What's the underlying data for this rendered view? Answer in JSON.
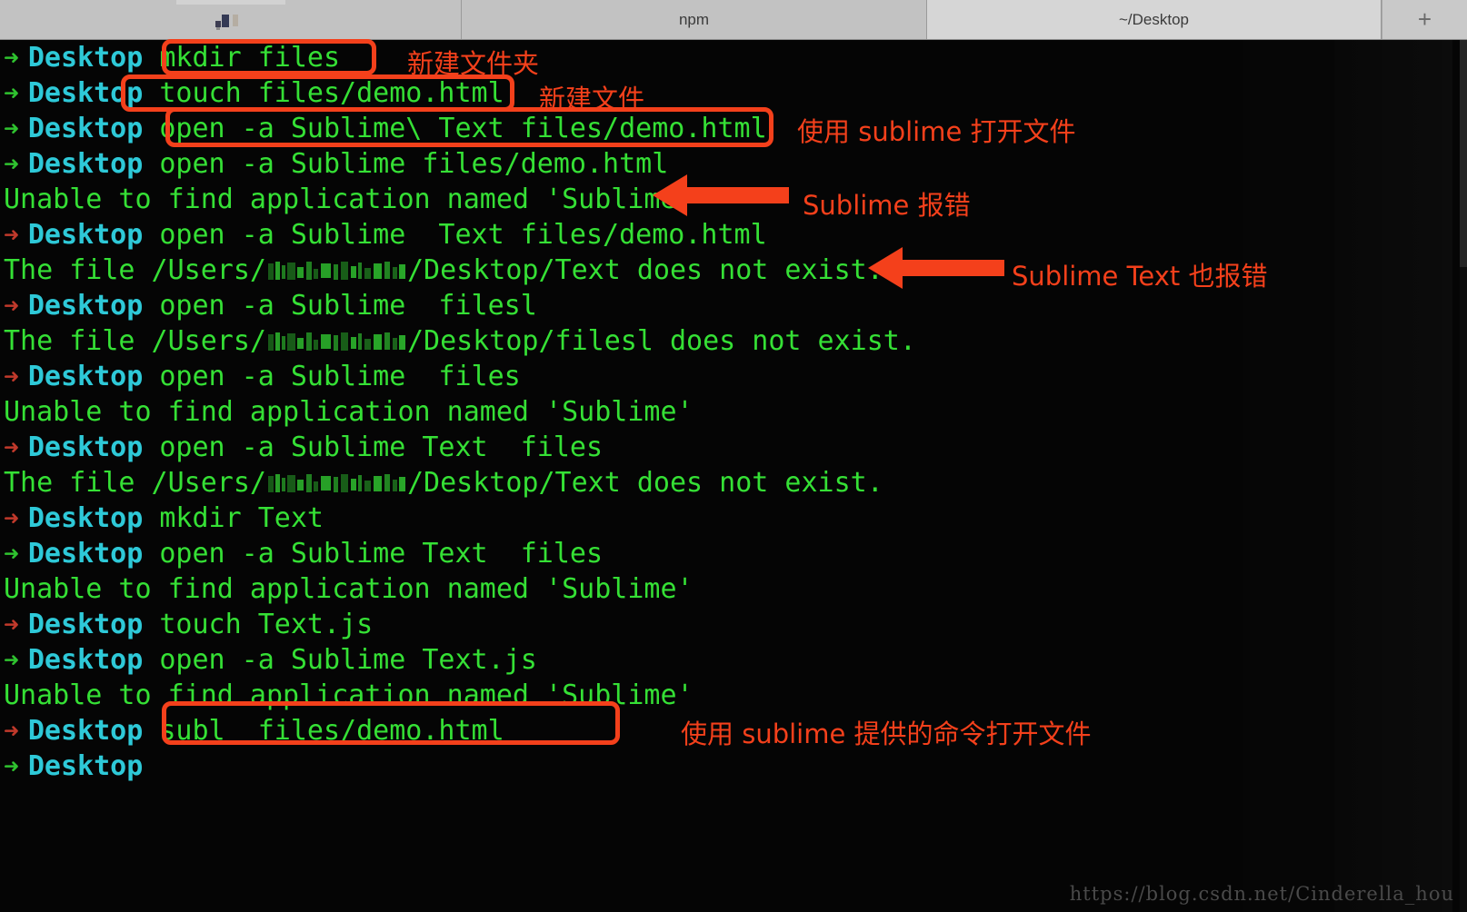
{
  "window": {
    "tabs": [
      {
        "label": "",
        "obscured": true,
        "active": false
      },
      {
        "label": "npm",
        "obscured": false,
        "active": false
      },
      {
        "label": "~/Desktop",
        "obscured": false,
        "active": true
      }
    ],
    "new_tab_label": "+"
  },
  "theme": {
    "background": "#050505",
    "tabbar_bg": "#c2c2c2",
    "tab_active_bg": "#d6d6d6",
    "prompt_arrow_green": "#2fc22f",
    "prompt_arrow_red": "#c0392b",
    "cwd_color": "#2ec9d8",
    "command_color": "#35e035",
    "output_color": "#35e035",
    "annotation_color": "#f4401b",
    "watermark_color": "#4a4a4a"
  },
  "terminal": {
    "prompt_cwd": "Desktop",
    "lines": [
      {
        "type": "prompt",
        "arrow": "green",
        "cwd": "Desktop",
        "command": "mkdir files"
      },
      {
        "type": "prompt",
        "arrow": "green",
        "cwd": "Desktop",
        "command": "touch files/demo.html"
      },
      {
        "type": "prompt",
        "arrow": "green",
        "cwd": "Desktop",
        "command": "open -a Sublime\\ Text files/demo.html"
      },
      {
        "type": "prompt",
        "arrow": "green",
        "cwd": "Desktop",
        "command": "open -a Sublime files/demo.html"
      },
      {
        "type": "output",
        "text": "Unable to find application named 'Sublime'"
      },
      {
        "type": "prompt",
        "arrow": "red",
        "cwd": "Desktop",
        "command": "open -a Sublime  Text files/demo.html"
      },
      {
        "type": "output-path",
        "prefix": "The file /Users/",
        "suffix": "/Desktop/Text does not exist."
      },
      {
        "type": "prompt",
        "arrow": "red",
        "cwd": "Desktop",
        "command": "open -a Sublime  filesl"
      },
      {
        "type": "output-path",
        "prefix": "The file /Users/",
        "suffix": "/Desktop/filesl does not exist."
      },
      {
        "type": "prompt",
        "arrow": "red",
        "cwd": "Desktop",
        "command": "open -a Sublime  files"
      },
      {
        "type": "output",
        "text": "Unable to find application named 'Sublime'"
      },
      {
        "type": "prompt",
        "arrow": "red",
        "cwd": "Desktop",
        "command": "open -a Sublime Text  files"
      },
      {
        "type": "output-path",
        "prefix": "The file /Users/",
        "suffix": "/Desktop/Text does not exist."
      },
      {
        "type": "prompt",
        "arrow": "red",
        "cwd": "Desktop",
        "command": "mkdir Text"
      },
      {
        "type": "prompt",
        "arrow": "green",
        "cwd": "Desktop",
        "command": "open -a Sublime Text  files"
      },
      {
        "type": "output",
        "text": "Unable to find application named 'Sublime'"
      },
      {
        "type": "prompt",
        "arrow": "red",
        "cwd": "Desktop",
        "command": "touch Text.js"
      },
      {
        "type": "prompt",
        "arrow": "green",
        "cwd": "Desktop",
        "command": "open -a Sublime Text.js"
      },
      {
        "type": "output",
        "text": "Unable to find application named 'Sublime'"
      },
      {
        "type": "prompt",
        "arrow": "red",
        "cwd": "Desktop",
        "command": "subl  files/demo.html"
      },
      {
        "type": "prompt",
        "arrow": "green",
        "cwd": "Desktop",
        "command": ""
      }
    ]
  },
  "annotations": {
    "notes": [
      {
        "id": "note-mkdir",
        "text": "新建文件夹"
      },
      {
        "id": "note-touch",
        "text": "新建文件"
      },
      {
        "id": "note-open-sublime",
        "text": "使用 sublime 打开文件"
      },
      {
        "id": "note-sublime-err",
        "text": "Sublime 报错"
      },
      {
        "id": "note-sublimetext-err",
        "text": "Sublime Text 也报错"
      },
      {
        "id": "note-subl-cmd",
        "text": "使用 sublime 提供的命令打开文件"
      }
    ]
  },
  "watermark": {
    "text": "https://blog.csdn.net/Cinderella_hou"
  }
}
